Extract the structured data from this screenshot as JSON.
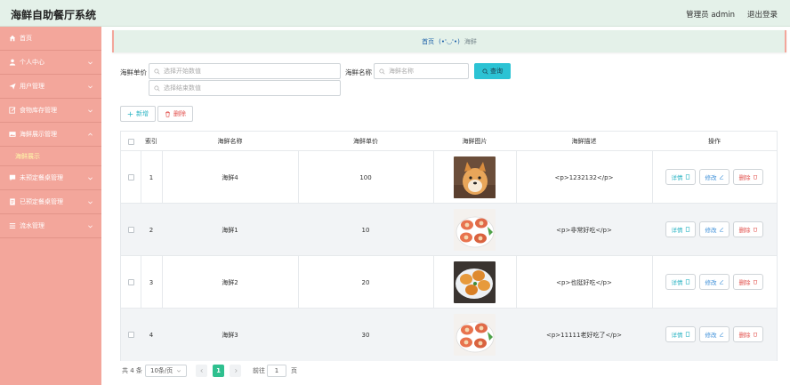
{
  "header": {
    "title": "海鲜自助餐厅系统",
    "user_label": "管理员 admin",
    "logout": "退出登录"
  },
  "sidebar": {
    "items": [
      {
        "label": "首页",
        "icon": "home-icon"
      },
      {
        "label": "个人中心",
        "icon": "user-icon"
      },
      {
        "label": "用户管理",
        "icon": "send-icon"
      },
      {
        "label": "食物库存管理",
        "icon": "edit-icon"
      },
      {
        "label": "海鲜展示管理",
        "icon": "picture-icon"
      },
      {
        "label": "海鲜展示",
        "sub": true
      },
      {
        "label": "未预定餐桌管理",
        "icon": "chat-icon"
      },
      {
        "label": "已预定餐桌管理",
        "icon": "document-icon"
      },
      {
        "label": "流水管理",
        "icon": "list-icon"
      }
    ]
  },
  "breadcrumb": {
    "home": "首页",
    "sep": "(•'◡'•)",
    "current": "海鲜"
  },
  "search": {
    "price_label": "海鲜单价",
    "price_start_placeholder": "选择开始数值",
    "price_end_placeholder": "选择结束数值",
    "name_label": "海鲜名称",
    "name_placeholder": "海鲜名称",
    "query_button": "查询"
  },
  "toolbar": {
    "add": "新增",
    "delete": "删除"
  },
  "table": {
    "headers": [
      "",
      "索引",
      "海鲜名称",
      "海鲜单价",
      "海鲜图片",
      "海鲜描述",
      "操作"
    ],
    "rows": [
      {
        "index": "1",
        "name": "海鲜4",
        "price": "100",
        "image": "shiba-dog",
        "desc": "<p>1232132</p>"
      },
      {
        "index": "2",
        "name": "海鲜1",
        "price": "10",
        "image": "scallop-plate",
        "desc": "<p>非常好吃</p>"
      },
      {
        "index": "3",
        "name": "海鲜2",
        "price": "20",
        "image": "fried-shrimp-plate",
        "desc": "<p>也挺好吃</p>"
      },
      {
        "index": "4",
        "name": "海鲜3",
        "price": "30",
        "image": "scallop-plate",
        "desc": "<p>11111老好吃了</p>"
      }
    ],
    "actions": {
      "detail": "详情",
      "edit": "修改",
      "delete": "删除"
    }
  },
  "pagination": {
    "total": "共 4 条",
    "page_size": "10条/页",
    "current_page": "1",
    "goto_label": "前往",
    "goto_value": "1",
    "page_suffix": "页"
  },
  "colors": {
    "sidebar": "#f3a69b",
    "header": "#e4f1e9",
    "query_button": "#2cc3d4",
    "active_page": "#2fc08f",
    "submenu_active": "#fff9a8"
  }
}
